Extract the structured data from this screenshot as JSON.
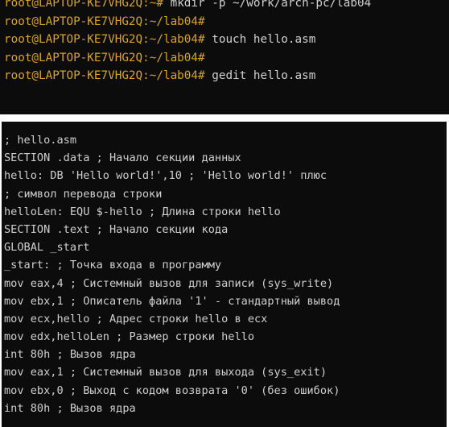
{
  "terminal": {
    "lines": [
      {
        "prompt": "root@LAPTOP-KE7VHG2Q:~#",
        "command": " mkdir -p ~/work/arch-pc/lab04"
      },
      {
        "prompt": "root@LAPTOP-KE7VHG2Q:~/lab04#",
        "command": ""
      },
      {
        "prompt": "root@LAPTOP-KE7VHG2Q:~/lab04#",
        "command": " touch hello.asm"
      },
      {
        "prompt": "root@LAPTOP-KE7VHG2Q:~/lab04#",
        "command": ""
      },
      {
        "prompt": "root@LAPTOP-KE7VHG2Q:~/lab04#",
        "command": " gedit hello.asm"
      }
    ]
  },
  "editor": {
    "lines": [
      "; hello.asm",
      "SECTION .data ; Начало секции данных",
      "hello: DB 'Hello world!',10 ; 'Hello world!' плюс",
      "; символ перевода строки",
      "helloLen: EQU $-hello ; Длина строки hello",
      "SECTION .text ; Начало секции кода",
      "GLOBAL _start",
      "_start: ; Точка входа в программу",
      "mov eax,4 ; Системный вызов для записи (sys_write)",
      "mov ebx,1 ; Описатель файла '1' - стандартный вывод",
      "mov ecx,hello ; Адрес строки hello в ecx",
      "mov edx,helloLen ; Размер строки hello",
      "int 80h ; Вызов ядра",
      "mov eax,1 ; Системный вызов для выхода (sys_exit)",
      "mov ebx,0 ; Выход с кодом возврата '0' (без ошибок)",
      "int 80h ; Вызов ядра"
    ]
  },
  "colors": {
    "background": "#0c0c0c",
    "prompt": "#d7a32a",
    "text": "#cfcfcf"
  }
}
